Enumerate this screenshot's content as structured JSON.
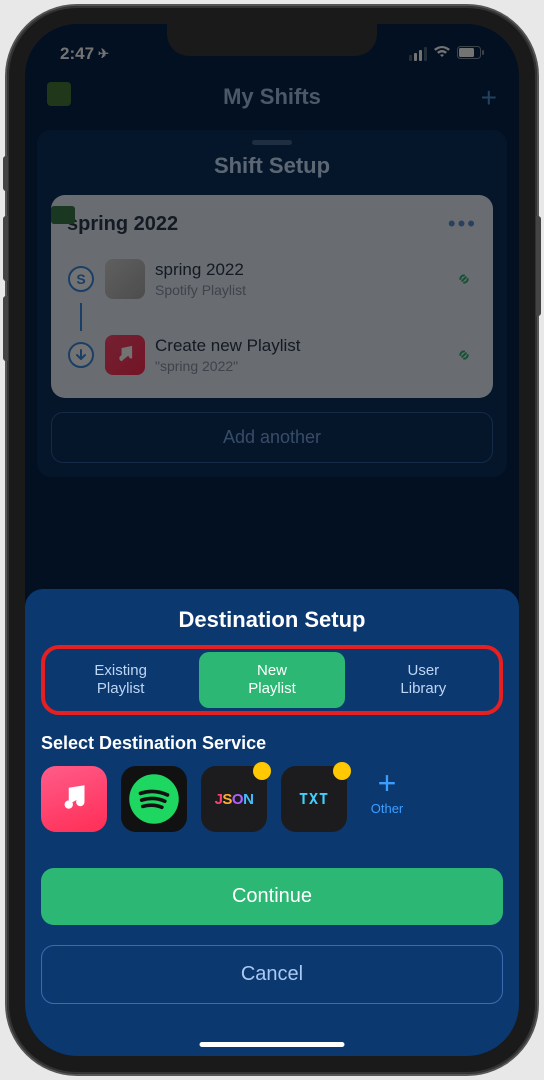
{
  "status": {
    "time": "2:47",
    "location_arrow": "➤"
  },
  "nav": {
    "title": "My Shifts"
  },
  "sheet": {
    "title": "Shift Setup"
  },
  "shift": {
    "name": "spring 2022",
    "source": {
      "title": "spring 2022",
      "subtitle": "Spotify Playlist"
    },
    "dest": {
      "title": "Create new Playlist",
      "subtitle": "\"spring 2022\""
    },
    "add_another": "Add another"
  },
  "destination": {
    "title": "Destination Setup",
    "segments": {
      "existing": "Existing\nPlaylist",
      "new": "New\nPlaylist",
      "user": "User\nLibrary"
    },
    "select_label": "Select Destination Service",
    "other_label": "Other",
    "json_label": "JSON",
    "txt_label": "TXT",
    "continue": "Continue",
    "cancel": "Cancel"
  }
}
